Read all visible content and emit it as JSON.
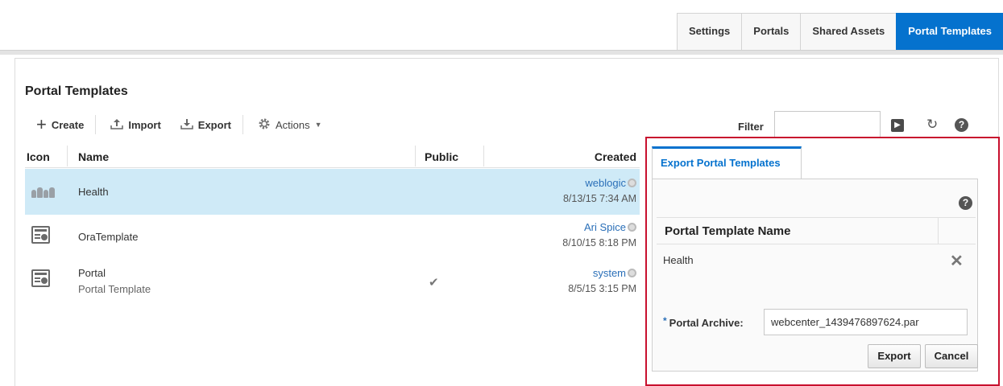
{
  "tabs": [
    {
      "label": "Settings"
    },
    {
      "label": "Portals"
    },
    {
      "label": "Shared Assets"
    },
    {
      "label": "Portal Templates"
    }
  ],
  "page": {
    "title": "Portal Templates"
  },
  "toolbar": {
    "create": "Create",
    "import": "Import",
    "export": "Export",
    "actions": "Actions"
  },
  "filter": {
    "label": "Filter",
    "value": ""
  },
  "table": {
    "columns": {
      "icon": "Icon",
      "name": "Name",
      "public": "Public",
      "created": "Created"
    },
    "rows": [
      {
        "name": "Health",
        "subtitle": "",
        "public": false,
        "creator": "weblogic",
        "date": "8/13/15 7:34 AM",
        "icon": "people-icon",
        "selected": true
      },
      {
        "name": "OraTemplate",
        "subtitle": "",
        "public": false,
        "creator": "Ari Spice",
        "date": "8/10/15 8:18 PM",
        "icon": "template-icon",
        "selected": false
      },
      {
        "name": "Portal",
        "subtitle": "Portal Template",
        "public": true,
        "creator": "system",
        "date": "8/5/15 3:15 PM",
        "icon": "template-icon",
        "selected": false
      }
    ]
  },
  "dialog": {
    "tab": "Export Portal Templates",
    "grid_header": "Portal Template Name",
    "grid_value": "Health",
    "archive_label": "Portal Archive:",
    "archive_required": "*",
    "archive_value": "webcenter_1439476897624.par",
    "export_button": "Export",
    "cancel_button": "Cancel"
  },
  "colors": {
    "accent": "#0572ce",
    "highlight": "#cfeaf7",
    "dialog_border": "#c8102e"
  }
}
